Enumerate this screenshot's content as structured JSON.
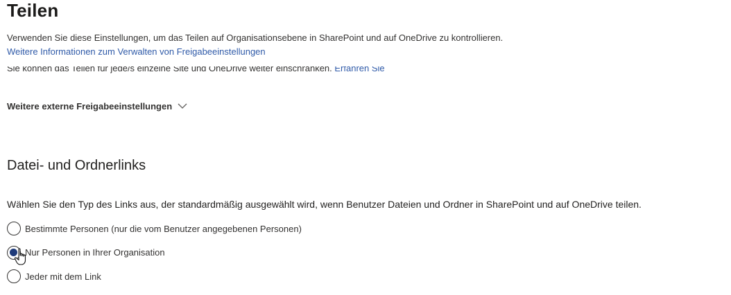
{
  "page": {
    "title": "Teilen",
    "intro": "Verwenden Sie diese Einstellungen, um das Teilen auf Organisationsebene in SharePoint und auf OneDrive zu kontrollieren.",
    "learn_more_link": "Weitere Informationen zum Verwalten von Freigabeeinstellungen",
    "clipped_text": "Sie können das Teilen für jede/s einzelne Site und OneDrive weiter einschränken.",
    "clipped_link": "Erfahren Sie"
  },
  "more_settings": {
    "label": "Weitere externe Freigabeeinstellungen",
    "icon": "chevron-down-icon"
  },
  "links_section": {
    "title": "Datei- und Ordnerlinks",
    "question": "Wählen Sie den Typ des Links aus, der standardmäßig ausgewählt wird, wenn Benutzer Dateien und Ordner in SharePoint und auf OneDrive teilen.",
    "options": [
      {
        "label": "Bestimmte Personen (nur die vom Benutzer angegebenen Personen)",
        "selected": false
      },
      {
        "label": "Nur Personen in Ihrer Organisation",
        "selected": true
      },
      {
        "label": "Jeder mit dem Link",
        "selected": false
      }
    ],
    "selected_index": 1
  },
  "colors": {
    "link": "#2f5aa8",
    "radio_fill": "#1f3b7a",
    "text": "#201f1e"
  }
}
